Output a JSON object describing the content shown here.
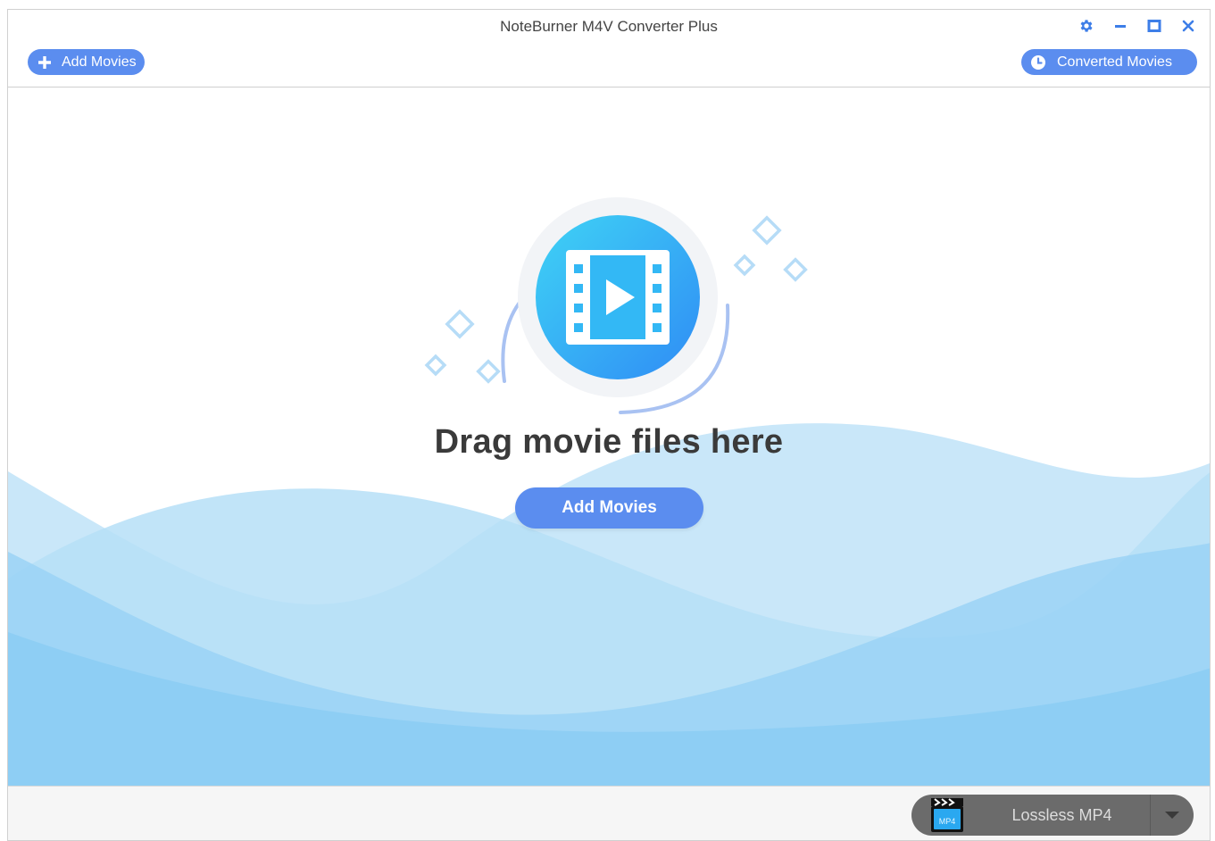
{
  "window": {
    "title": "NoteBurner M4V Converter Plus"
  },
  "toolbar": {
    "add_movies_label": "Add Movies",
    "add_movies_icon": "plus-icon",
    "converted_movies_label": "Converted Movies",
    "converted_movies_icon": "clock-icon"
  },
  "window_controls": {
    "settings_icon": "gear-icon",
    "minimize_icon": "minimize-icon",
    "maximize_icon": "maximize-icon",
    "close_icon": "close-icon"
  },
  "main": {
    "drop_title": "Drag movie files here",
    "add_movies_label": "Add Movies",
    "hero_icon": "video-film-icon"
  },
  "footer": {
    "output_format": "Lossless MP4",
    "format_icon": "mp4-clapperboard-icon",
    "format_badge": "MP4",
    "dropdown_icon": "chevron-down-icon"
  },
  "colors": {
    "accent": "#5b8def",
    "title_text": "#444444",
    "control_icon": "#3d7ee8",
    "wave_light": "#c9e7f9",
    "wave_mid": "#a6d7f5",
    "wave_dark": "#8ccdf4",
    "footer_bg": "#f6f6f6",
    "format_pill": "#6b6b6b"
  }
}
